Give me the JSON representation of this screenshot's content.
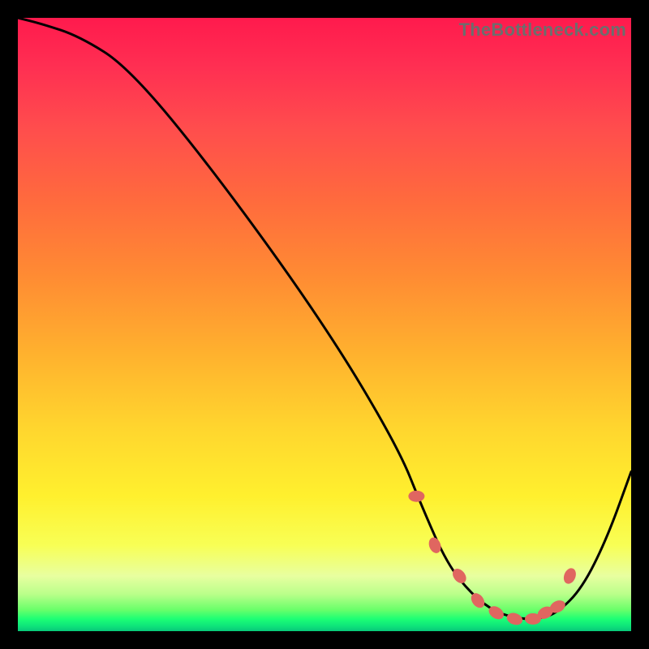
{
  "watermark": "TheBottleneck.com",
  "chart_data": {
    "type": "line",
    "title": "",
    "xlabel": "",
    "ylabel": "",
    "xlim": [
      0,
      100
    ],
    "ylim": [
      0,
      100
    ],
    "grid": false,
    "legend": false,
    "series": [
      {
        "name": "curve",
        "x": [
          0,
          4,
          10,
          18,
          32,
          50,
          62,
          66,
          70,
          74,
          78,
          82,
          85,
          88,
          92,
          96,
          100
        ],
        "values": [
          100,
          99,
          97,
          92,
          75,
          50,
          30,
          20,
          11,
          6,
          3,
          2,
          2,
          3,
          7,
          15,
          26
        ]
      }
    ],
    "markers": {
      "name": "highlighted-points",
      "x": [
        65,
        68,
        72,
        75,
        78,
        81,
        84,
        86,
        88,
        90
      ],
      "values": [
        22,
        14,
        9,
        5,
        3,
        2,
        2,
        3,
        4,
        9
      ]
    },
    "gradient_colors": {
      "top": "#ff1a4d",
      "mid_upper": "#ff8b33",
      "mid": "#ffd62e",
      "mid_lower": "#f8ff55",
      "bottom": "#10e87a"
    }
  }
}
